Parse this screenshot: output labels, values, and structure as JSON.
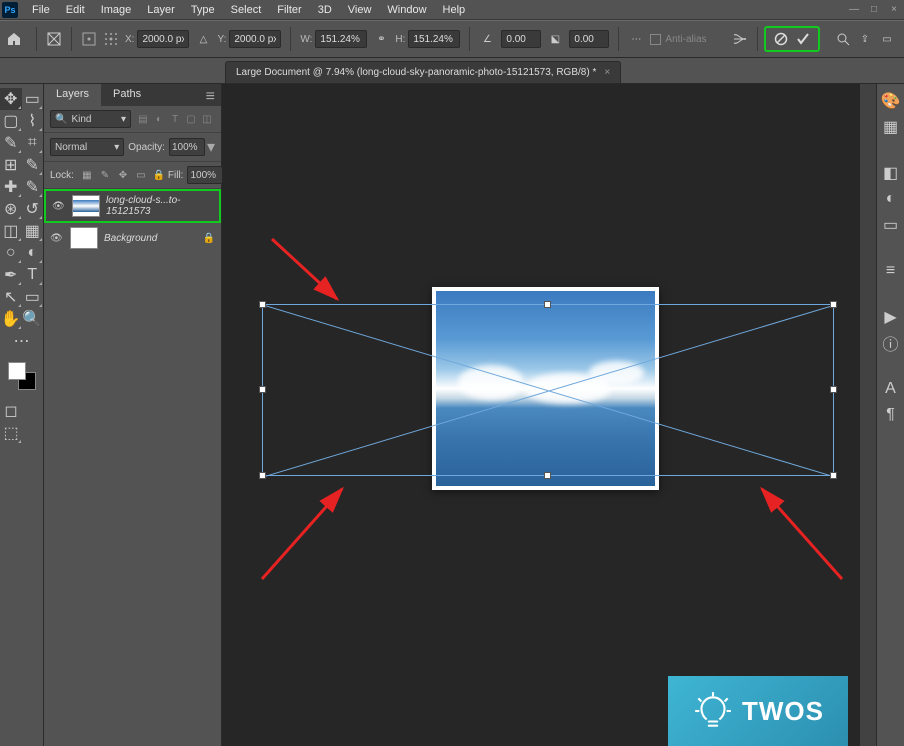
{
  "menu": {
    "items": [
      "File",
      "Edit",
      "Image",
      "Layer",
      "Type",
      "Select",
      "Filter",
      "3D",
      "View",
      "Window",
      "Help"
    ]
  },
  "options": {
    "x_label": "X:",
    "x_value": "2000.0 px",
    "y_label": "Y:",
    "y_value": "2000.0 px",
    "w_label": "W:",
    "w_value": "151.24%",
    "h_label": "H:",
    "h_value": "151.24%",
    "angle_label": "",
    "angle_value": "0.00",
    "skew_label": "",
    "skew_value": "0.00",
    "antialias_label": "Anti-alias"
  },
  "doc_tab": "Large Document @ 7.94% (long-cloud-sky-panoramic-photo-15121573, RGB/8) *",
  "layers": {
    "tabs": [
      "Layers",
      "Paths"
    ],
    "search_kind": "Kind",
    "blend_mode": "Normal",
    "opacity_label": "Opacity:",
    "opacity_value": "100%",
    "lock_label": "Lock:",
    "fill_label": "Fill:",
    "fill_value": "100%",
    "items": [
      {
        "name": "long-cloud-s...to-15121573",
        "selected": true,
        "bg": false
      },
      {
        "name": "Background",
        "selected": false,
        "bg": true
      }
    ]
  },
  "watermark": {
    "text": "TWOS"
  }
}
